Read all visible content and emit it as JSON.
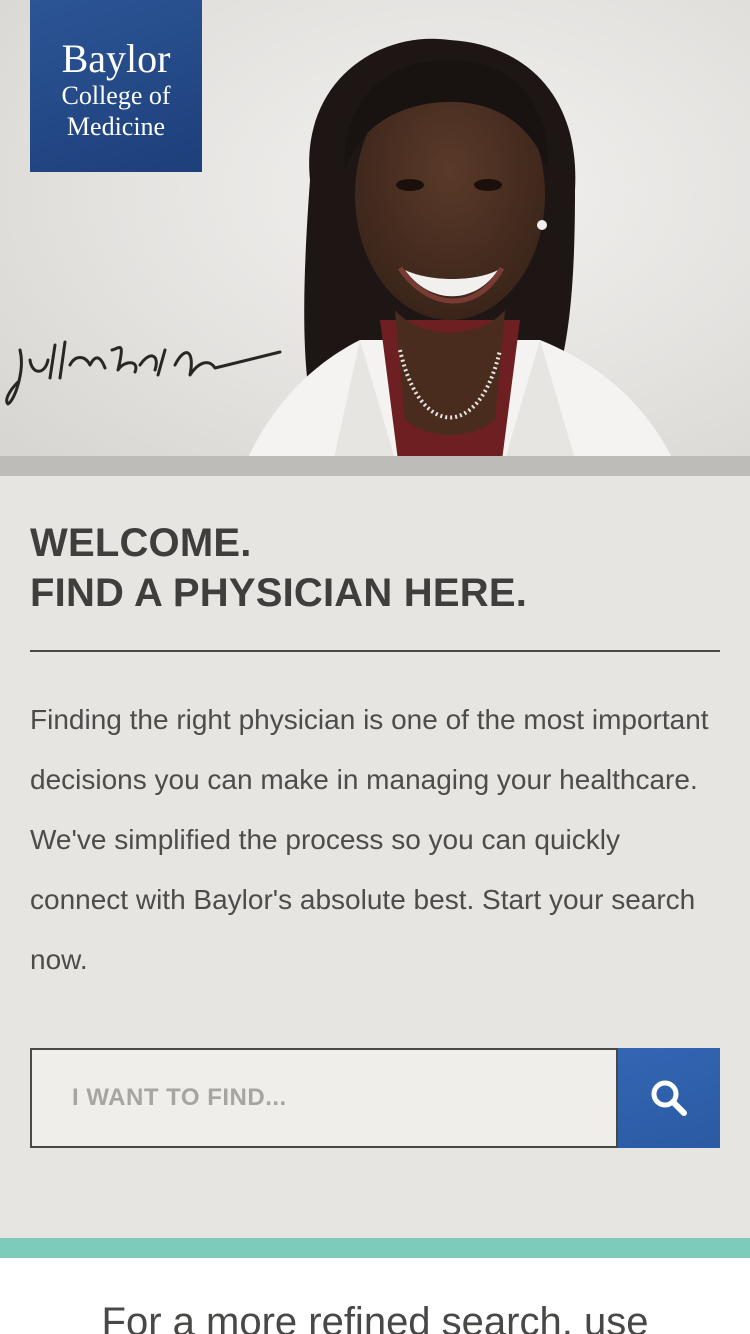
{
  "logo": {
    "line1": "Baylor",
    "line2": "College of",
    "line3": "Medicine",
    "bg_color": "#24498a"
  },
  "hero": {
    "portrait_icon": "physician-portrait",
    "signature_icon": "handwritten-signature"
  },
  "main": {
    "heading_line1": "WELCOME.",
    "heading_line2": "FIND A PHYSICIAN HERE.",
    "intro": "Finding the right physician is one of the most important decisions you can make in managing your healthcare. We've simplified the process so you can quickly connect with Baylor's absolute best. Start your search now."
  },
  "search": {
    "placeholder": "I WANT TO FIND...",
    "value": "",
    "button_icon": "search-icon",
    "button_color": "#2f5fac"
  },
  "footer": {
    "refined_text": "For a more refined search, use",
    "accent_color": "#7ccbbb"
  }
}
